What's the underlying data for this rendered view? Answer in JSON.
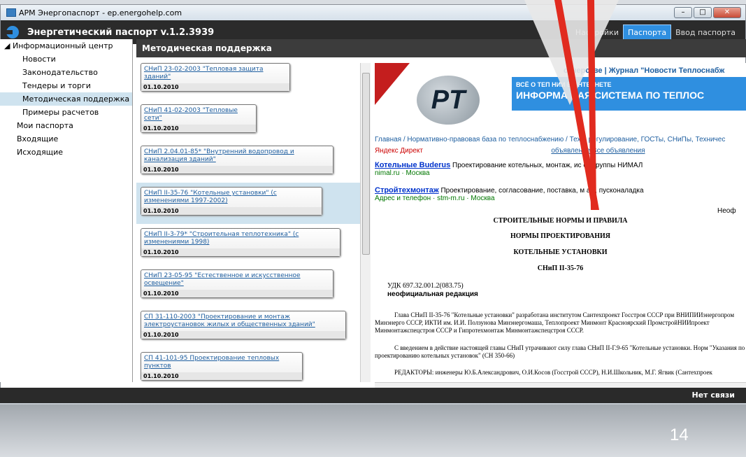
{
  "window": {
    "title": "АРМ Энергопаспорт - ep.energohelp.com"
  },
  "app": {
    "title": "Энергетический паспорт v.1.2.3939",
    "menu": [
      "Настройки",
      "Паспорта",
      "Ввод паспорта"
    ],
    "active_menu": "Паспорта"
  },
  "nav": {
    "root": "Информационный центр",
    "items": [
      "Новости",
      "Законодательство",
      "Тендеры и торги",
      "Методическая поддержка",
      "Примеры расчетов"
    ],
    "other": [
      "Мои паспорта",
      "Входящие",
      "Исходящие"
    ]
  },
  "section_title": "Методическая поддержка",
  "docs": [
    {
      "title": "СНиП 23-02-2003 \"Тепловая защита зданий\"",
      "date": "01.10.2010"
    },
    {
      "title": "СНиП 41-02-2003 \"Тепловые сети\"",
      "date": "01.10.2010"
    },
    {
      "title": "СНиП 2.04.01-85* \"Внутренний водопровод и канализация зданий\"",
      "date": "01.10.2010"
    },
    {
      "title": "СНиП II-35-76 \"Котельные установки\" (с изменениями 1997-2002)",
      "date": "01.10.2010"
    },
    {
      "title": "СНиП II-3-79* \"Строительная теплотехника\" (с изменениями 1998)",
      "date": "01.10.2010"
    },
    {
      "title": "СНиП 23-05-95 \"Естественное и искусственное освещение\"",
      "date": "01.10.2010"
    },
    {
      "title": "СП 31-110-2003 \"Проектирование и монтаж электроустановок жилых и общественных зданий\"",
      "date": "01.10.2010"
    },
    {
      "title": "СП 41-101-95 Проектирование тепловых пунктов",
      "date": "01.10.2010"
    }
  ],
  "web": {
    "toplinks": "отнерстве | Журнал \"Новости Теплоснабж",
    "banner1": "ВСЁ О ТЕП      НИИ В ИНТЕРНЕТЕ",
    "banner2": "ИНФОРМА      НАЯ СИСТЕМА ПО ТЕПЛОС",
    "logo": "PT",
    "crumbs": "Главная / Нормативно-правовая база по теплоснабжению / Тех      е регулирование, ГОСТы, СНиПы, Техничес",
    "yandex": "Яндекс  Директ",
    "yandex_links": "объявление   Все объявления",
    "ad1_title": "Котельные Buderus",
    "ad1_text": "Проектирование котельных, монтаж,    ис от Группы НИМАЛ",
    "ad1_green": "nimal.ru · Москва",
    "ad2_title": "Стройтехмонтаж",
    "ad2_text": "Проектирование, согласование, поставка, м   аж, пусконаладка",
    "ad2_green": "Адрес и телефон · stm-m.ru · Москва",
    "neof": "Неоф",
    "h1": "СТРОИТЕЛЬНЫЕ НОРМЫ И ПРАВИЛА",
    "h2": "НОРМЫ ПРОЕКТИРОВАНИЯ",
    "h3": "КОТЕЛЬНЫЕ УСТАНОВКИ",
    "h4": "СНиП II-35-76",
    "udk": "УДК 697.32.001.2(083.75)",
    "unofficial": "неофициальная редакция",
    "p1": "Глава СНиП II-35-76 \"Котельные установки\" разработана институтом Сантехпроект Госстроя СССР при ВНИПИИэнергопром Минэнерго СССР, ИКТИ им. И.И. Ползунова Минэнергомаша, Теплопроект Минмонт Красноярский ПромстройНИИпроект Минмонтажспецстроя СССР и Гипротехмонтаж Минмонтажспецстроя СССР.",
    "p2": "С введением в действие настоящей главы СНиП утрачивают силу глава СНиП II-Г.9-65 \"Котельные установки. Норм \"Указания по проектированию котельных установок\" (СН 350-66)",
    "p3": "РЕДАКТОРЫ: инженеры Ю.Б.Александрович, О.И.Косов (Госстрой СССР), Н.И.Школьник, М.Г. Ягвик (Сантехпроек"
  },
  "status": "Нет связи",
  "slide_number": "14"
}
